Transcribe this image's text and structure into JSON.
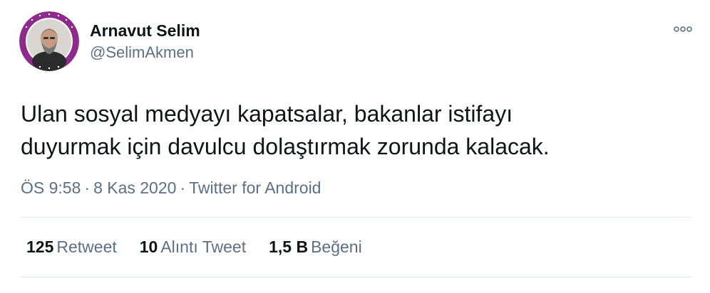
{
  "tweet": {
    "display_name": "Arnavut Selim",
    "username": "@SelimAkmen",
    "text_lines": [
      "Ulan sosyal medyayı kapatsalar, bakanlar istifayı",
      "duyurmak için davulcu dolaştırmak zorunda kalacak."
    ],
    "time": "ÖS 9:58",
    "date": "8 Kas 2020",
    "separator": "·",
    "source": "Twitter for Android",
    "stats": {
      "retweets_count": "125",
      "retweets_label": "Retweet",
      "quotes_count": "10",
      "quotes_label": "Alıntı Tweet",
      "likes_count": "1,5 B",
      "likes_label": "Beğeni"
    }
  },
  "colors": {
    "avatar_ring": "#8e2a8b",
    "text_primary": "#0f1419",
    "text_secondary": "#5b7083",
    "divider": "#e1e8ed"
  },
  "icons": {
    "more": "more-options-icon"
  }
}
